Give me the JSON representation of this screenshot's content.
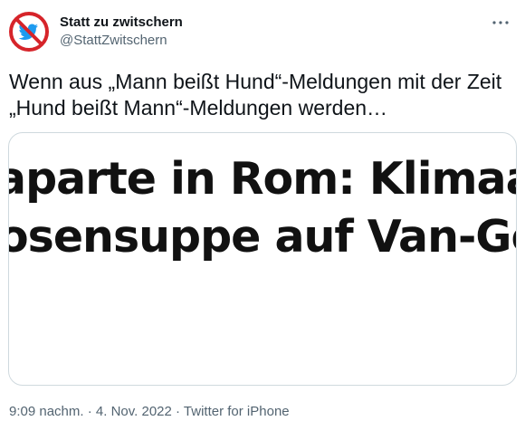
{
  "author": {
    "display_name": "Statt zu zwitschern",
    "handle": "@StattZwitschern"
  },
  "tweet": {
    "text": "Wenn aus „Mann beißt Hund“-Meldungen mit der Zeit\n„Hund beißt Mann“-Meldungen werden…"
  },
  "media": {
    "headline_line1": "aparte in Rom: Klimaakt",
    "headline_line2": "osensuppe auf Van-Gogh"
  },
  "meta": {
    "time": "9:09 nachm.",
    "separator1": " · ",
    "date": "4. Nov. 2022",
    "separator2": " · ",
    "source": "Twitter for iPhone"
  },
  "icons": {
    "avatar": "no-bird-icon",
    "more": "more-dots-icon"
  },
  "colors": {
    "avatar_ring": "#d6242a",
    "avatar_bird": "#1d9bf0",
    "secondary_text": "#536471",
    "card_border": "#cfd9de"
  }
}
